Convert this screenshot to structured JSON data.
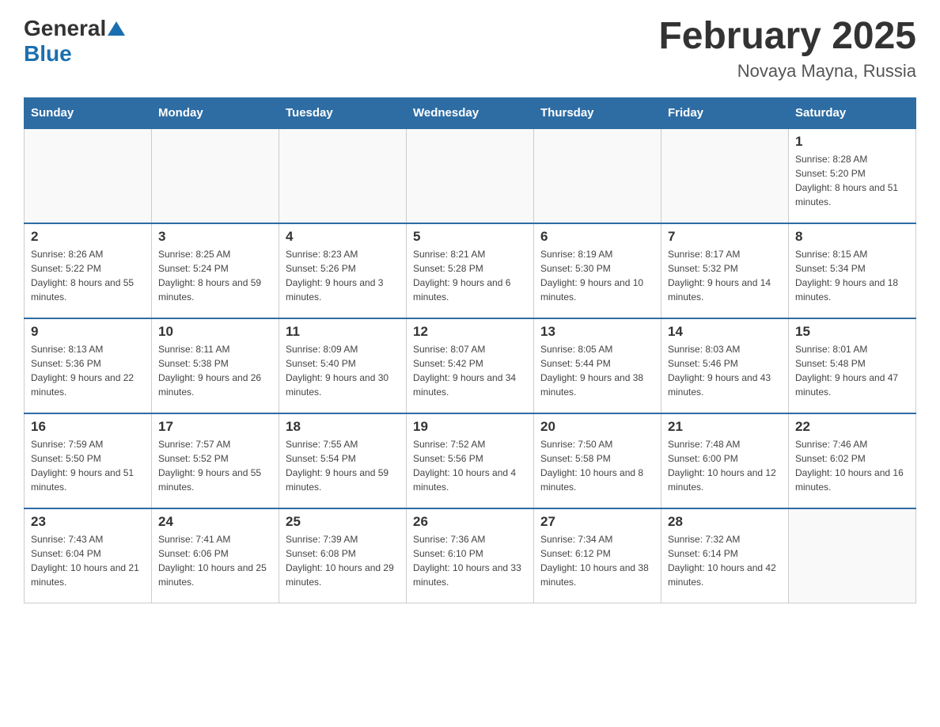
{
  "header": {
    "logo_general": "General",
    "logo_blue": "Blue",
    "title": "February 2025",
    "subtitle": "Novaya Mayna, Russia"
  },
  "weekdays": [
    "Sunday",
    "Monday",
    "Tuesday",
    "Wednesday",
    "Thursday",
    "Friday",
    "Saturday"
  ],
  "weeks": [
    [
      {
        "day": "",
        "info": ""
      },
      {
        "day": "",
        "info": ""
      },
      {
        "day": "",
        "info": ""
      },
      {
        "day": "",
        "info": ""
      },
      {
        "day": "",
        "info": ""
      },
      {
        "day": "",
        "info": ""
      },
      {
        "day": "1",
        "info": "Sunrise: 8:28 AM\nSunset: 5:20 PM\nDaylight: 8 hours and 51 minutes."
      }
    ],
    [
      {
        "day": "2",
        "info": "Sunrise: 8:26 AM\nSunset: 5:22 PM\nDaylight: 8 hours and 55 minutes."
      },
      {
        "day": "3",
        "info": "Sunrise: 8:25 AM\nSunset: 5:24 PM\nDaylight: 8 hours and 59 minutes."
      },
      {
        "day": "4",
        "info": "Sunrise: 8:23 AM\nSunset: 5:26 PM\nDaylight: 9 hours and 3 minutes."
      },
      {
        "day": "5",
        "info": "Sunrise: 8:21 AM\nSunset: 5:28 PM\nDaylight: 9 hours and 6 minutes."
      },
      {
        "day": "6",
        "info": "Sunrise: 8:19 AM\nSunset: 5:30 PM\nDaylight: 9 hours and 10 minutes."
      },
      {
        "day": "7",
        "info": "Sunrise: 8:17 AM\nSunset: 5:32 PM\nDaylight: 9 hours and 14 minutes."
      },
      {
        "day": "8",
        "info": "Sunrise: 8:15 AM\nSunset: 5:34 PM\nDaylight: 9 hours and 18 minutes."
      }
    ],
    [
      {
        "day": "9",
        "info": "Sunrise: 8:13 AM\nSunset: 5:36 PM\nDaylight: 9 hours and 22 minutes."
      },
      {
        "day": "10",
        "info": "Sunrise: 8:11 AM\nSunset: 5:38 PM\nDaylight: 9 hours and 26 minutes."
      },
      {
        "day": "11",
        "info": "Sunrise: 8:09 AM\nSunset: 5:40 PM\nDaylight: 9 hours and 30 minutes."
      },
      {
        "day": "12",
        "info": "Sunrise: 8:07 AM\nSunset: 5:42 PM\nDaylight: 9 hours and 34 minutes."
      },
      {
        "day": "13",
        "info": "Sunrise: 8:05 AM\nSunset: 5:44 PM\nDaylight: 9 hours and 38 minutes."
      },
      {
        "day": "14",
        "info": "Sunrise: 8:03 AM\nSunset: 5:46 PM\nDaylight: 9 hours and 43 minutes."
      },
      {
        "day": "15",
        "info": "Sunrise: 8:01 AM\nSunset: 5:48 PM\nDaylight: 9 hours and 47 minutes."
      }
    ],
    [
      {
        "day": "16",
        "info": "Sunrise: 7:59 AM\nSunset: 5:50 PM\nDaylight: 9 hours and 51 minutes."
      },
      {
        "day": "17",
        "info": "Sunrise: 7:57 AM\nSunset: 5:52 PM\nDaylight: 9 hours and 55 minutes."
      },
      {
        "day": "18",
        "info": "Sunrise: 7:55 AM\nSunset: 5:54 PM\nDaylight: 9 hours and 59 minutes."
      },
      {
        "day": "19",
        "info": "Sunrise: 7:52 AM\nSunset: 5:56 PM\nDaylight: 10 hours and 4 minutes."
      },
      {
        "day": "20",
        "info": "Sunrise: 7:50 AM\nSunset: 5:58 PM\nDaylight: 10 hours and 8 minutes."
      },
      {
        "day": "21",
        "info": "Sunrise: 7:48 AM\nSunset: 6:00 PM\nDaylight: 10 hours and 12 minutes."
      },
      {
        "day": "22",
        "info": "Sunrise: 7:46 AM\nSunset: 6:02 PM\nDaylight: 10 hours and 16 minutes."
      }
    ],
    [
      {
        "day": "23",
        "info": "Sunrise: 7:43 AM\nSunset: 6:04 PM\nDaylight: 10 hours and 21 minutes."
      },
      {
        "day": "24",
        "info": "Sunrise: 7:41 AM\nSunset: 6:06 PM\nDaylight: 10 hours and 25 minutes."
      },
      {
        "day": "25",
        "info": "Sunrise: 7:39 AM\nSunset: 6:08 PM\nDaylight: 10 hours and 29 minutes."
      },
      {
        "day": "26",
        "info": "Sunrise: 7:36 AM\nSunset: 6:10 PM\nDaylight: 10 hours and 33 minutes."
      },
      {
        "day": "27",
        "info": "Sunrise: 7:34 AM\nSunset: 6:12 PM\nDaylight: 10 hours and 38 minutes."
      },
      {
        "day": "28",
        "info": "Sunrise: 7:32 AM\nSunset: 6:14 PM\nDaylight: 10 hours and 42 minutes."
      },
      {
        "day": "",
        "info": ""
      }
    ]
  ]
}
